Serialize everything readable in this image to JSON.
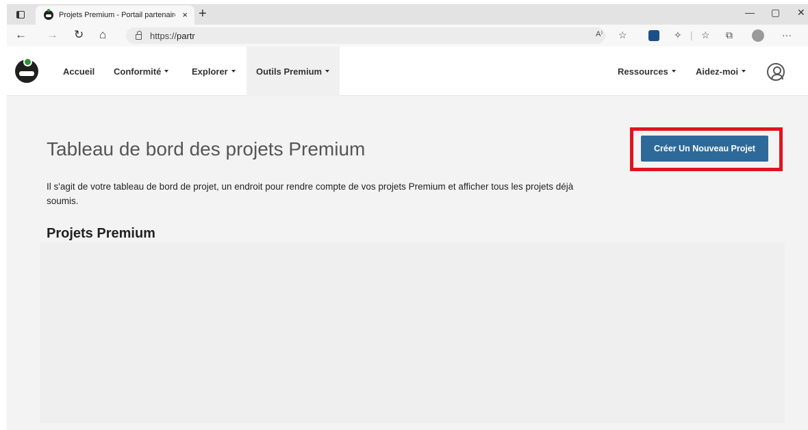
{
  "browser": {
    "tab_title": "Projets Premium - Portail partenaire",
    "tab_close": "×",
    "new_tab": "+",
    "window_controls": {
      "minimize": "—",
      "restore": "▢",
      "close": "✕"
    },
    "nav": {
      "back": "←",
      "forward": "→",
      "refresh": "↻",
      "home": "⌂"
    },
    "url_prefix": "https://",
    "url_rest": "partr",
    "toolbar_icons": [
      "read-aloud-icon",
      "favorite-add-icon",
      "extension-icon",
      "puzzle-icon",
      "favorites-icon",
      "collections-icon",
      "profile-icon",
      "more-icon"
    ],
    "toolbar_glyphs": {
      "read_aloud": "A⁾",
      "favorite_add": "☆",
      "favorites": "☆",
      "collections": "⧉",
      "more": "···"
    }
  },
  "site_nav": {
    "items": [
      {
        "label": "Accueil",
        "has_dropdown": false
      },
      {
        "label": "Conformité",
        "has_dropdown": true
      },
      {
        "label": "Explorer",
        "has_dropdown": true
      },
      {
        "label": "Outils Premium",
        "has_dropdown": true,
        "active": true
      },
      {
        "label": "Ressources",
        "has_dropdown": true
      },
      {
        "label": "Aidez-moi",
        "has_dropdown": true
      }
    ]
  },
  "page": {
    "title": "Tableau de bord des projets Premium",
    "intro": "Il s'agit de votre tableau de bord de projet, un endroit pour rendre compte de vos projets Premium et afficher tous les projets déjà soumis.",
    "section_title": "Projets Premium",
    "create_button": "Créer Un Nouveau Projet"
  },
  "colors": {
    "primary_button": "#2e6a99",
    "highlight_border": "#e0141e",
    "page_background": "#f3f3f3"
  }
}
